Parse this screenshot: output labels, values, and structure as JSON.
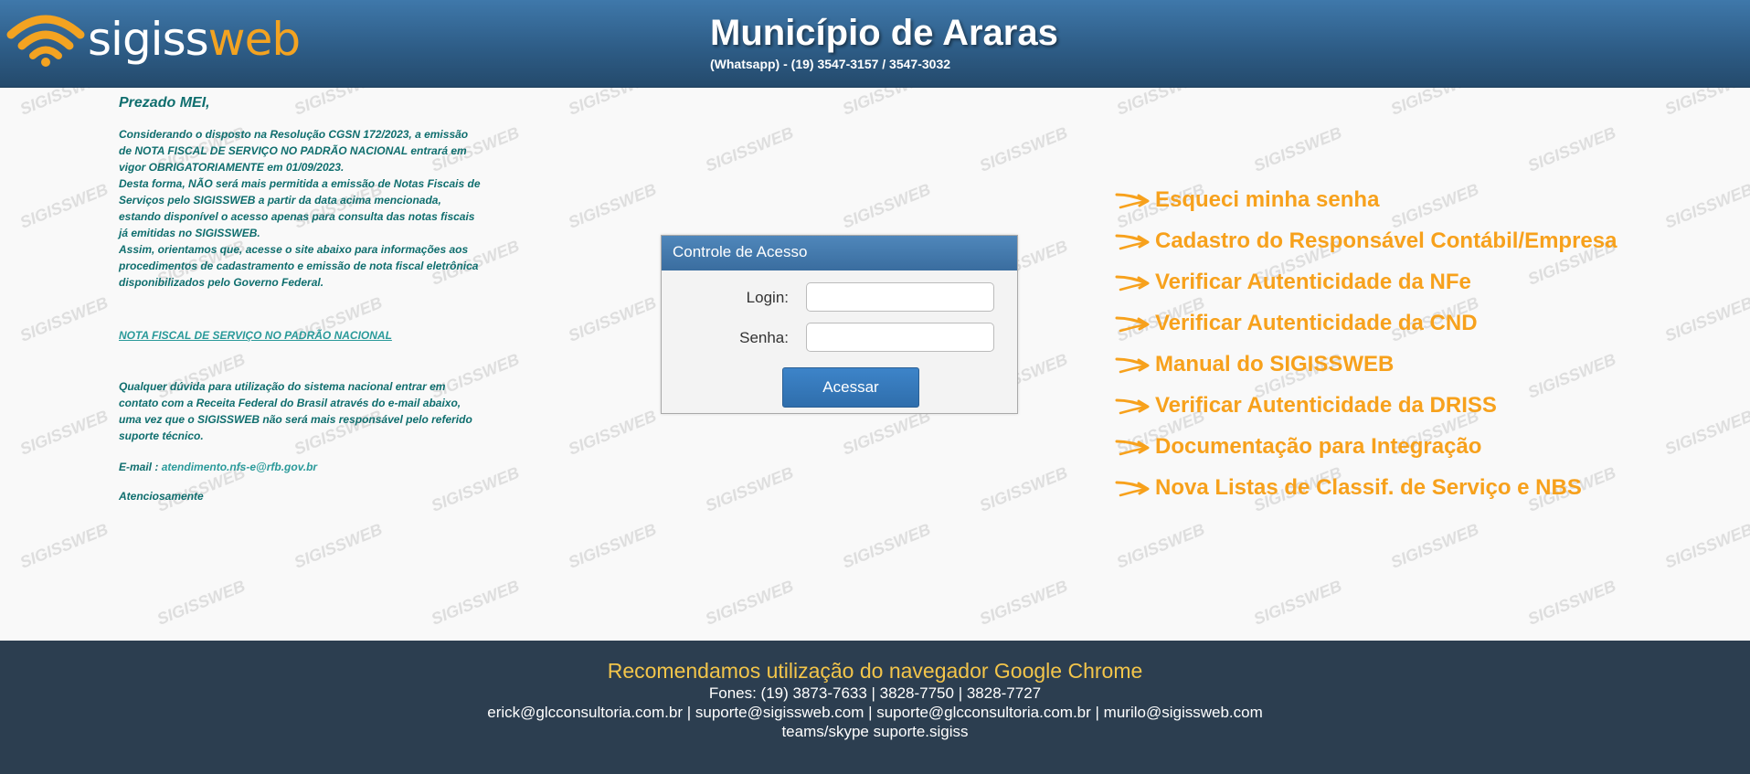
{
  "header": {
    "logo_text_white": "sigiss",
    "logo_text_orange": "web",
    "title": "Município de Araras",
    "phone": "(Whatsapp) - (19) 3547-3157 / 3547-3032"
  },
  "watermark_text": "SIGISSWEB",
  "notice": {
    "greeting": "Prezado MEI,",
    "lines1": [
      "Considerando o disposto na Resolução CGSN 172/2023, a emissão",
      "de NOTA FISCAL DE SERVIÇO NO PADRÃO NACIONAL entrará em",
      "vigor OBRIGATORIAMENTE em 01/09/2023.",
      "Desta forma, NÃO será mais permitida a emissão de Notas Fiscais de",
      "Serviços pelo SIGISSWEB a partir da data acima mencionada,",
      "estando disponível o acesso apenas para consulta das notas fiscais",
      "já emitidas no SIGISSWEB.",
      "Assim, orientamos que, acesse o site abaixo para informações aos",
      "procedimentos de cadastramento e emissão de nota fiscal eletrônica",
      "disponibilizados pelo Governo Federal."
    ],
    "link": "NOTA FISCAL DE SERVIÇO NO PADRÃO NACIONAL",
    "lines2": [
      "Qualquer dúvida para utilização do sistema nacional entrar em",
      "contato com a Receita Federal do Brasil através do e-mail abaixo,",
      "uma vez que o SIGISSWEB não será mais responsável pelo referido",
      "suporte técnico."
    ],
    "email_label": "E-mail : ",
    "email_value": "atendimento.nfs-e@rfb.gov.br",
    "signoff": "Atenciosamente"
  },
  "login": {
    "title": "Controle de Acesso",
    "login_label": "Login:",
    "login_value": "",
    "password_label": "Senha:",
    "password_value": "",
    "submit_label": "Acessar"
  },
  "links": [
    "Esqueci minha senha",
    "Cadastro do Responsável Contábil/Empresa",
    "Verificar Autenticidade da NFe",
    "Verificar Autenticidade da CND",
    "Manual do SIGISSWEB",
    "Verificar Autenticidade da DRISS",
    "Documentação para Integração",
    "Nova Listas de Classif. de Serviço e NBS"
  ],
  "footer": {
    "recommendation": "Recomendamos utilização do navegador Google Chrome",
    "phones": "Fones: (19) 3873-7633 | 3828-7750 | 3828-7727",
    "emails": "erick@glcconsultoria.com.br | suporte@sigissweb.com | suporte@glcconsultoria.com.br | murilo@sigissweb.com",
    "teams": "teams/skype suporte.sigiss"
  },
  "colors": {
    "header_blue": "#2e5d87",
    "logo_orange": "#f3a321",
    "link_orange": "#f7a11c",
    "notice_teal": "#0f6e6e",
    "footer_bg": "#2c3e50",
    "footer_highlight": "#f3c54a",
    "button_blue": "#3d84c9"
  },
  "icons": {
    "logo": "wifi-signal-icon",
    "link_bullet": "swoosh-arrow-icon"
  }
}
